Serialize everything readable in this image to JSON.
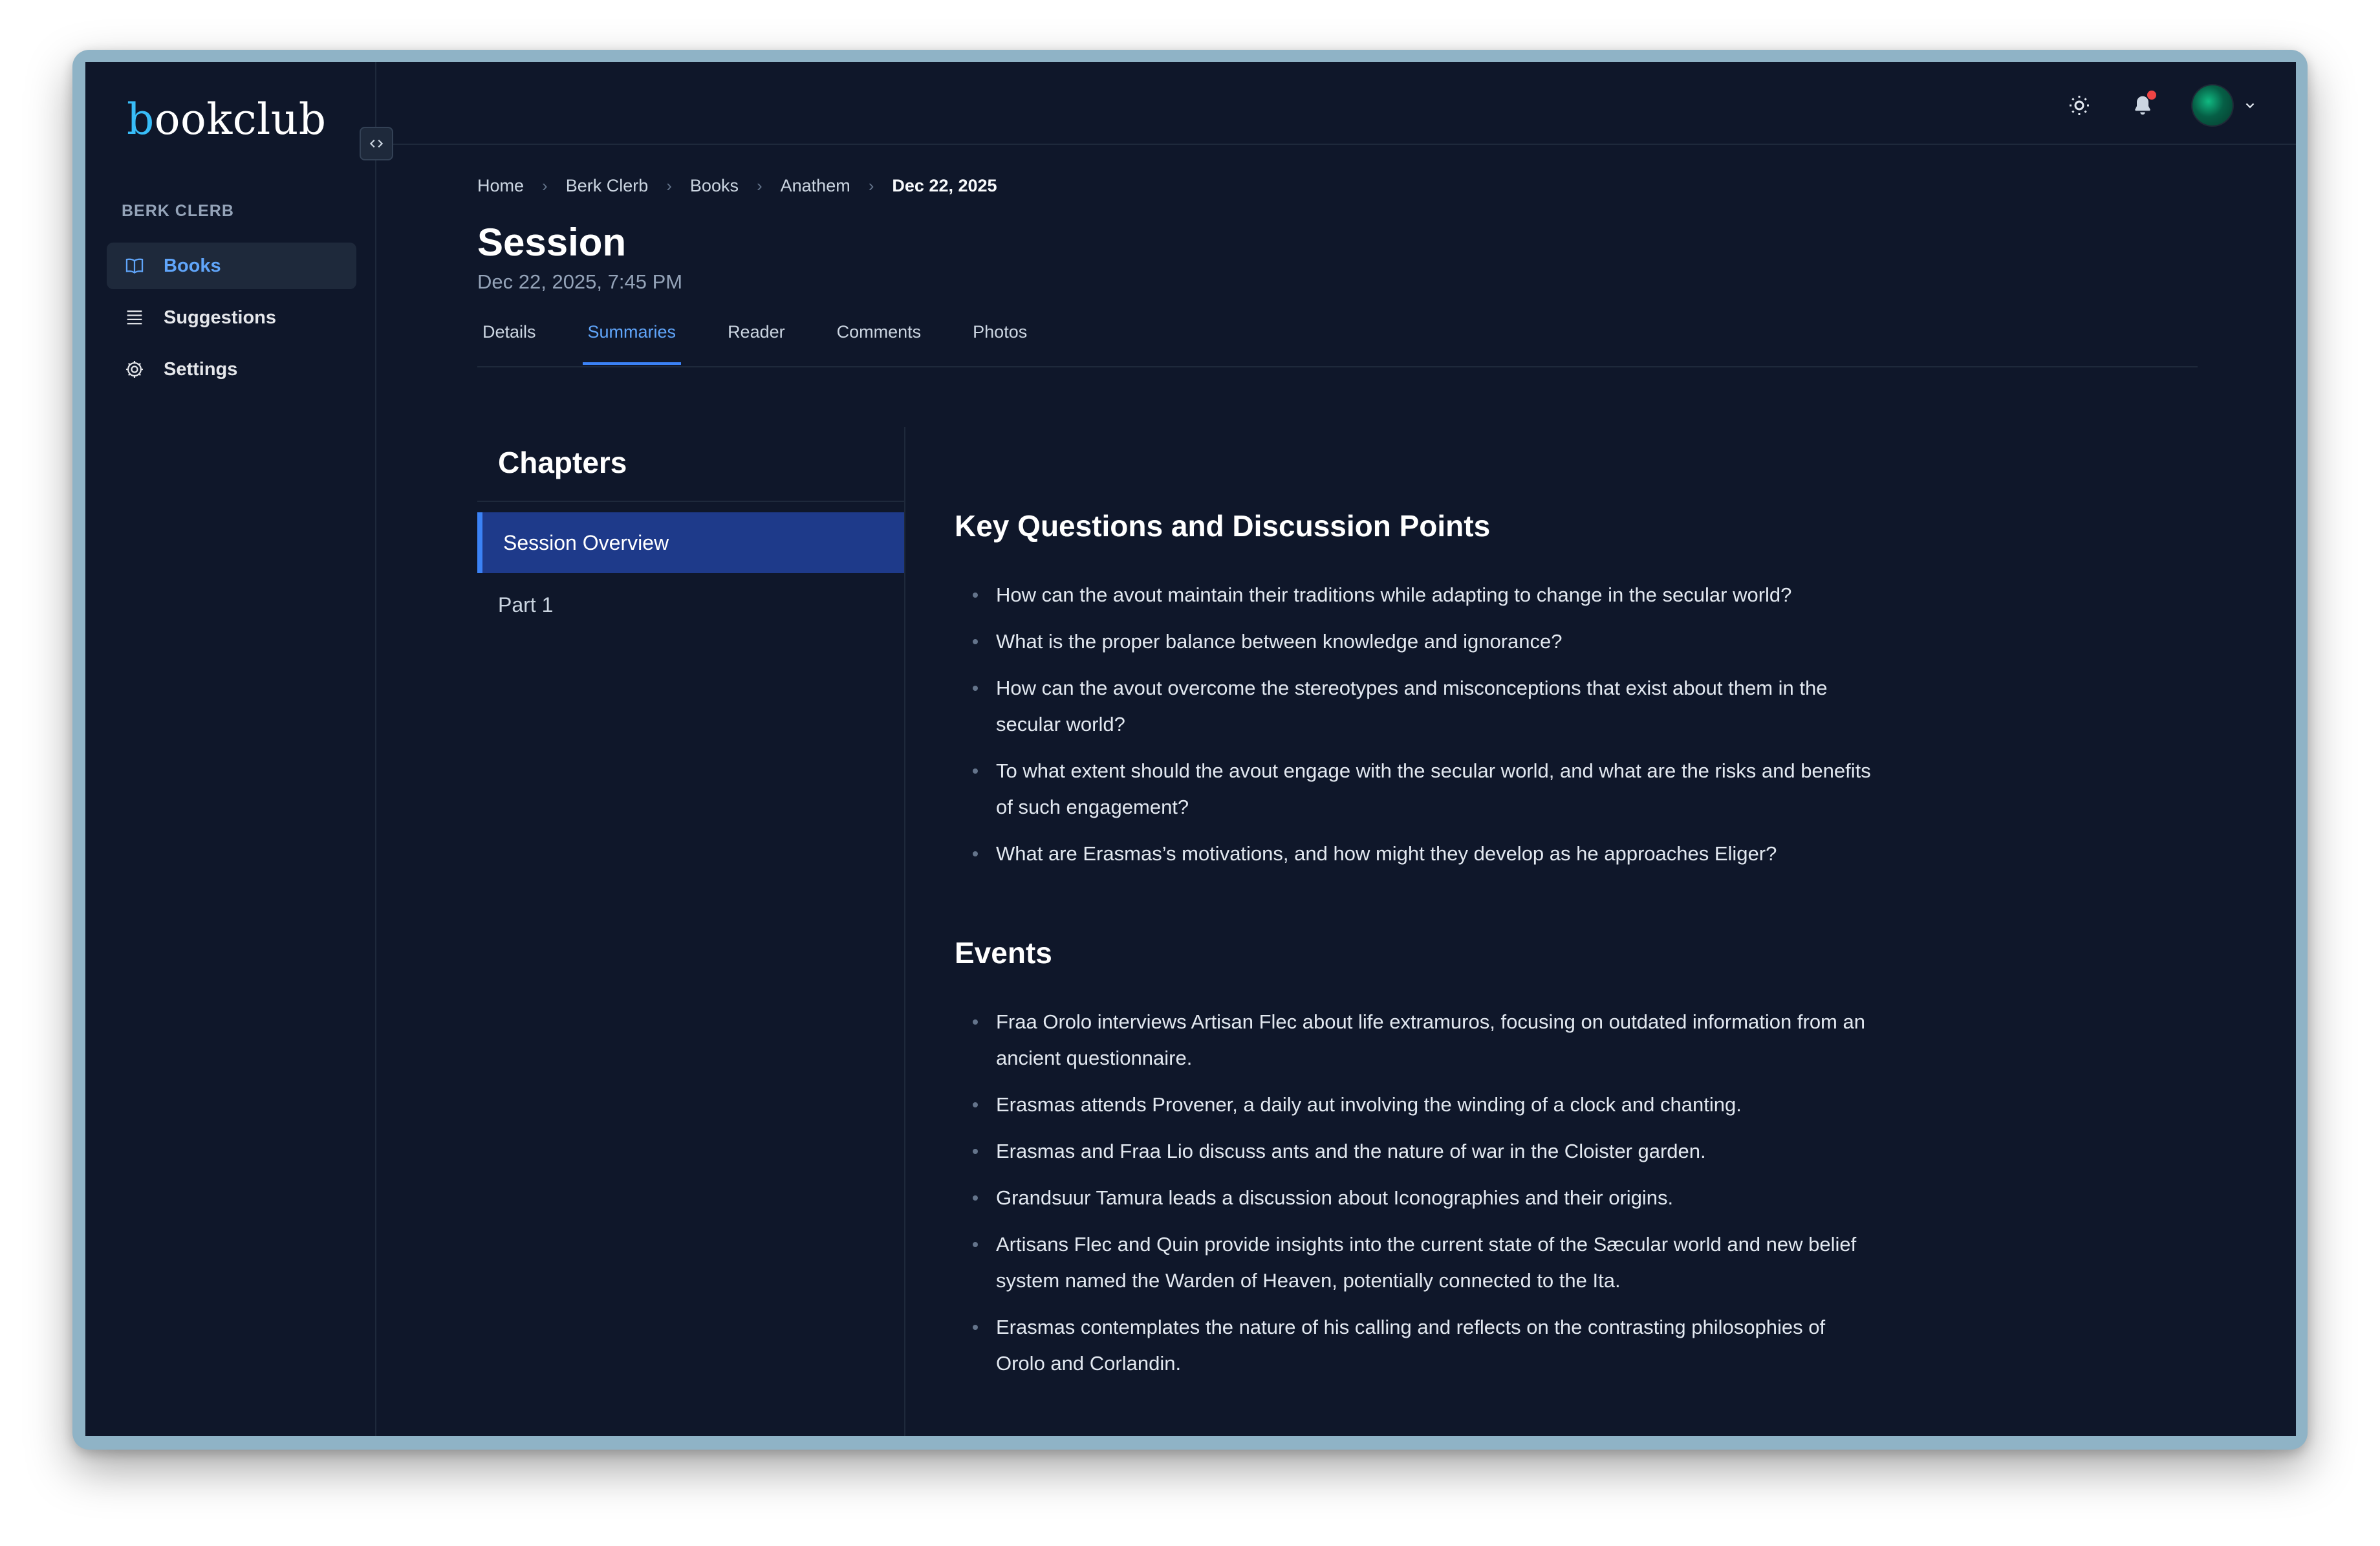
{
  "app": {
    "logo_b": "b",
    "logo_rest": "ookclub"
  },
  "sidebar": {
    "section_label": "BERK CLERB",
    "items": [
      {
        "label": "Books",
        "icon": "book-icon",
        "active": true
      },
      {
        "label": "Suggestions",
        "icon": "list-icon",
        "active": false
      },
      {
        "label": "Settings",
        "icon": "gear-icon",
        "active": false
      }
    ]
  },
  "topbar": {
    "icons": [
      "sun-icon",
      "bell-icon",
      "avatar",
      "chevron-down-icon"
    ],
    "notification_dot_color": "#ef4444"
  },
  "breadcrumb": [
    "Home",
    "Berk Clerb",
    "Books",
    "Anathem",
    "Dec 22, 2025"
  ],
  "page": {
    "title": "Session",
    "subtitle": "Dec 22, 2025, 7:45 PM"
  },
  "tabs": [
    {
      "label": "Details",
      "active": false
    },
    {
      "label": "Summaries",
      "active": true
    },
    {
      "label": "Reader",
      "active": false
    },
    {
      "label": "Comments",
      "active": false
    },
    {
      "label": "Photos",
      "active": false
    }
  ],
  "chapters": {
    "heading": "Chapters",
    "items": [
      {
        "label": "Session Overview",
        "active": true
      },
      {
        "label": "Part 1",
        "active": false
      }
    ]
  },
  "content": {
    "key_questions": {
      "heading": "Key Questions and Discussion Points",
      "items": [
        "How can the avout maintain their traditions while adapting to change in the secular world?",
        "What is the proper balance between knowledge and ignorance?",
        "How can the avout overcome the stereotypes and misconceptions that exist about them in the secular world?",
        "To what extent should the avout engage with the secular world, and what are the risks and benefits of such engagement?",
        "What are Erasmas’s motivations, and how might they develop as he approaches Eliger?"
      ]
    },
    "events": {
      "heading": "Events",
      "items": [
        "Fraa Orolo interviews Artisan Flec about life extramuros, focusing on outdated information from an ancient questionnaire.",
        "Erasmas attends Provener, a daily aut involving the winding of a clock and chanting.",
        "Erasmas and Fraa Lio discuss ants and the nature of war in the Cloister garden.",
        "Grandsuur Tamura leads a discussion about Iconographies and their origins.",
        "Artisans Flec and Quin provide insights into the current state of the Sæcular world and new belief system named the Warden of Heaven, potentially connected to the Ita.",
        "Erasmas contemplates the nature of his calling and reflects on the contrasting philosophies of Orolo and Corlandin."
      ]
    }
  },
  "colors": {
    "background": "#0f172a",
    "accent": "#60a5fa",
    "active_chapter": "#1e3a8a"
  }
}
